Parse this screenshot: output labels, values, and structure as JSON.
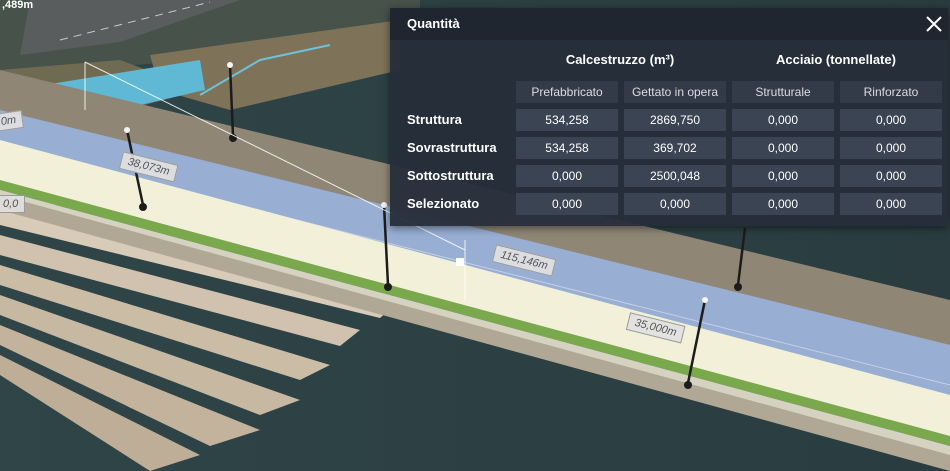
{
  "scene": {
    "corner_label": ",489m",
    "dimensions": [
      {
        "id": "left-edge",
        "text": "0m"
      },
      {
        "id": "left-lower",
        "text": "0,0"
      },
      {
        "id": "span-a",
        "text": "38,073m"
      },
      {
        "id": "span-b",
        "text": "115,146m"
      },
      {
        "id": "span-c",
        "text": "35,000m"
      }
    ]
  },
  "panel": {
    "title": "Quantità",
    "close_icon": "close-icon",
    "groups": {
      "concrete": "Calcestruzzo (m³)",
      "steel": "Acciaio (tonnellate)"
    },
    "columns": [
      "Prefabbricato",
      "Gettato in opera",
      "Strutturale",
      "Rinforzato"
    ],
    "rows": [
      {
        "label": "Struttura",
        "values": [
          "534,258",
          "2869,750",
          "0,000",
          "0,000"
        ]
      },
      {
        "label": "Sovrastruttura",
        "values": [
          "534,258",
          "369,702",
          "0,000",
          "0,000"
        ]
      },
      {
        "label": "Sottostruttura",
        "values": [
          "0,000",
          "2500,048",
          "0,000",
          "0,000"
        ]
      },
      {
        "label": "Selezionato",
        "values": [
          "0,000",
          "0,000",
          "0,000",
          "0,000"
        ]
      }
    ]
  }
}
